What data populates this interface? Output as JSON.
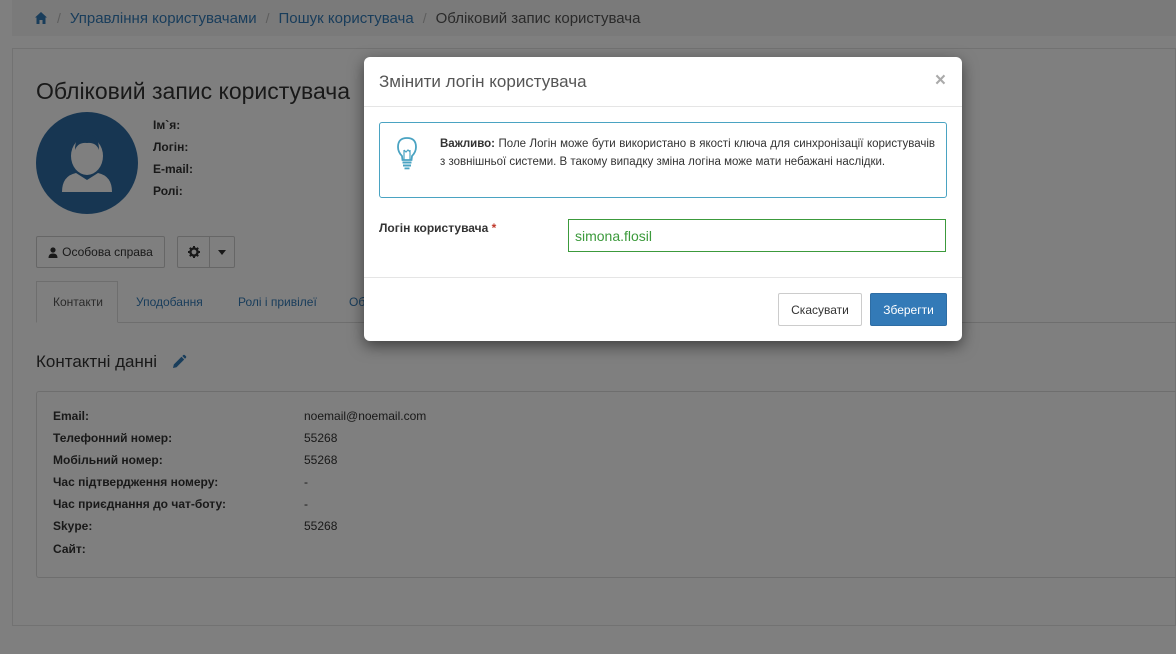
{
  "breadcrumb": {
    "items": [
      "Управління користувачами",
      "Пошук користувача",
      "Обліковий запис користувача"
    ]
  },
  "page": {
    "title": "Обліковий запис користувача",
    "info_labels": [
      "Ім`я:",
      "Логін:",
      "E-mail:",
      "Ролі:"
    ],
    "personal_file_button": "Особова справа",
    "tabs": [
      "Контакти",
      "Уподобання",
      "Ролі і привілеї",
      "Об"
    ],
    "section_title": "Контактні данні"
  },
  "contacts": [
    {
      "label": "Email:",
      "value": "noemail@noemail.com"
    },
    {
      "label": "Телефонний номер:",
      "value": "55268"
    },
    {
      "label": "Мобільний номер:",
      "value": "55268"
    },
    {
      "label": "Час підтвердження номеру:",
      "value": "-"
    },
    {
      "label": "Час приєднання до чат-боту:",
      "value": "-"
    },
    {
      "label": "Skype:",
      "value": "55268"
    },
    {
      "label": "Сайт:",
      "value": ""
    }
  ],
  "modal": {
    "title": "Змінити логін користувача",
    "close_symbol": "×",
    "alert_strong": "Важливо:",
    "alert_text": " Поле Логін може бути використано в якості ключа для синхронізації користувачів з зовнішньої системи. В такому випадку зміна логіна може мати небажані наслідки.",
    "login_label": "Логін користувача",
    "required_mark": "*",
    "login_value": "simona.flosil",
    "cancel_label": "Скасувати",
    "save_label": "Зберегти"
  },
  "colors": {
    "primary": "#337ab7",
    "success_border": "#3c9a3c",
    "info_border": "#4aa3c2",
    "avatar_bg": "#2e6da4"
  },
  "icons": [
    "home-icon",
    "user-icon",
    "gear-icon",
    "caret-down-icon",
    "pencil-icon",
    "lightbulb-icon",
    "close-icon"
  ]
}
